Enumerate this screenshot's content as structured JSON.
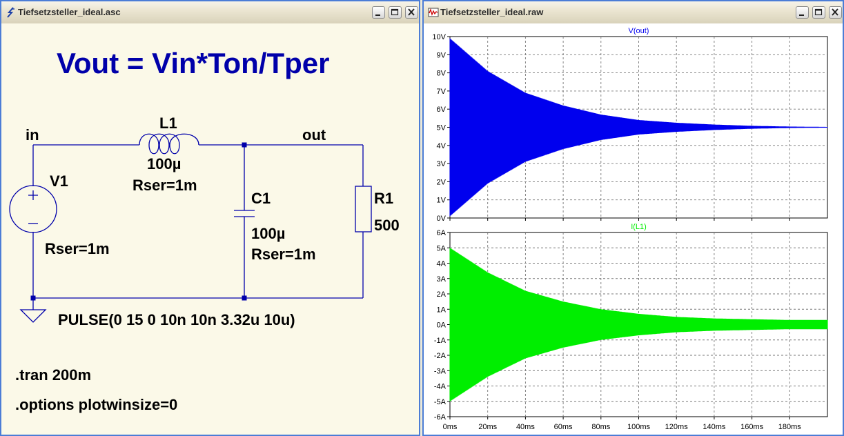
{
  "schematic_window": {
    "title": "Tiefsetzsteller_ideal.asc",
    "heading": "Vout = Vin*Ton/Tper",
    "nets": {
      "in": "in",
      "out": "out"
    },
    "components": {
      "V1": {
        "name": "V1",
        "rser": "Rser=1m",
        "value": "PULSE(0 15 0 10n 10n 3.32u 10u)"
      },
      "L1": {
        "name": "L1",
        "value": "100µ",
        "rser": "Rser=1m"
      },
      "C1": {
        "name": "C1",
        "value": "100µ",
        "rser": "Rser=1m"
      },
      "R1": {
        "name": "R1",
        "value": "500"
      }
    },
    "directives": [
      ".tran 200m",
      ".options plotwinsize=0"
    ]
  },
  "plot_window": {
    "title": "Tiefsetzsteller_ideal.raw"
  },
  "colors": {
    "vout": "#0000ee",
    "il1": "#00ee00",
    "schematic_text": "#000000",
    "heading": "#0000aa",
    "wire": "#0000aa",
    "window_border": "#4c7dd6"
  },
  "chart_data": [
    {
      "type": "line",
      "title": "V(out)",
      "x_ticks": [
        "0ms",
        "20ms",
        "40ms",
        "60ms",
        "80ms",
        "100ms",
        "120ms",
        "140ms",
        "160ms",
        "180ms"
      ],
      "y_ticks": [
        "0V",
        "1V",
        "2V",
        "3V",
        "4V",
        "5V",
        "6V",
        "7V",
        "8V",
        "9V",
        "10V"
      ],
      "xlim": [
        0,
        200
      ],
      "ylim": [
        0,
        10
      ],
      "grid": true,
      "series": [
        {
          "name": "V(out)",
          "color": "#0000ee",
          "description_points": {
            "x": [
              0,
              20,
              40,
              60,
              80,
              100,
              120,
              140,
              160,
              180,
              200
            ],
            "max": [
              9.9,
              8.1,
              6.9,
              6.2,
              5.7,
              5.4,
              5.25,
              5.15,
              5.08,
              5.04,
              5.02
            ],
            "min": [
              0.1,
              1.9,
              3.1,
              3.8,
              4.3,
              4.6,
              4.75,
              4.85,
              4.92,
              4.96,
              4.98
            ]
          }
        }
      ]
    },
    {
      "type": "line",
      "title": "I(L1)",
      "x_ticks": [
        "0ms",
        "20ms",
        "40ms",
        "60ms",
        "80ms",
        "100ms",
        "120ms",
        "140ms",
        "160ms",
        "180ms"
      ],
      "y_ticks": [
        "-6A",
        "-5A",
        "-4A",
        "-3A",
        "-2A",
        "-1A",
        "0A",
        "1A",
        "2A",
        "3A",
        "4A",
        "5A",
        "6A"
      ],
      "xlim": [
        0,
        200
      ],
      "ylim": [
        -6,
        6
      ],
      "grid": true,
      "series": [
        {
          "name": "I(L1)",
          "color": "#00ee00",
          "description_points": {
            "x": [
              0,
              20,
              40,
              60,
              80,
              100,
              120,
              140,
              160,
              180,
              200
            ],
            "max": [
              5.0,
              3.4,
              2.2,
              1.5,
              1.0,
              0.7,
              0.5,
              0.4,
              0.35,
              0.3,
              0.3
            ],
            "min": [
              -5.0,
              -3.4,
              -2.2,
              -1.5,
              -1.0,
              -0.7,
              -0.5,
              -0.4,
              -0.35,
              -0.3,
              -0.3
            ]
          }
        }
      ]
    }
  ]
}
